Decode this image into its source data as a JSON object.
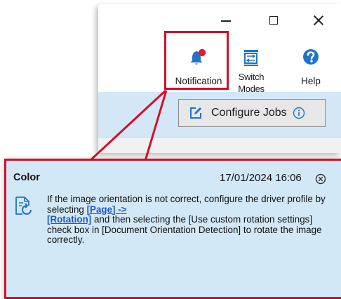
{
  "window": {
    "controls": {
      "minimize_icon": "minimize-icon",
      "maximize_icon": "maximize-icon",
      "close_icon": "close-icon"
    }
  },
  "ribbon": {
    "notification": {
      "label": "Notification",
      "icon": "bell-icon-with-red-badge"
    },
    "switch_modes": {
      "label_line1": "Switch",
      "label_line2": "Modes",
      "icon": "switch-modes-icon"
    },
    "help": {
      "label": "Help",
      "icon": "help-question-icon"
    }
  },
  "toolbar": {
    "configure_jobs_label": "Configure Jobs",
    "configure_icon": "edit-square-icon",
    "info_icon": "info-circle-icon"
  },
  "notification_popup": {
    "title": "Color",
    "timestamp": "17/01/2024 16:06",
    "close_icon": "close-circle-icon",
    "doc_icon": "document-rotate-icon",
    "message": {
      "part1": "If the image orientation is not correct, configure the driver profile by selecting ",
      "link1": "[Page] ->",
      "link2": "[Rotation]",
      "part2": " and then selecting the [Use custom rotation settings] check box in [Document Orientation Detection] to rotate the image correctly."
    }
  },
  "colors": {
    "highlight_red": "#d0102b",
    "panel_blue": "#d3e7f6",
    "link_blue": "#1f57c6",
    "badge_red": "#e0202e",
    "icon_blue": "#1f73c8"
  }
}
